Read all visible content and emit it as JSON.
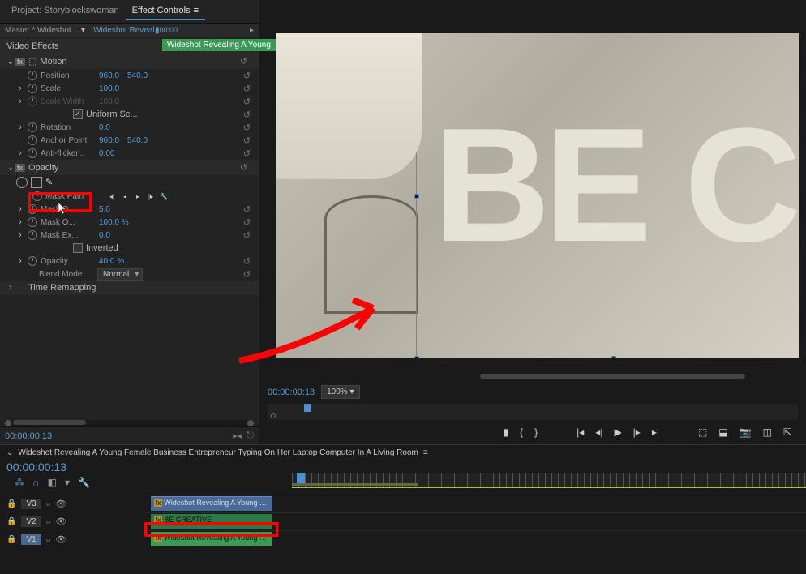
{
  "tabs": {
    "project": "Project: Storyblockswoman",
    "effectControls": "Effect Controls"
  },
  "header": {
    "master": "Master * Wideshot...",
    "clip": "Wideshot Reveal...",
    "time": "00:00"
  },
  "tooltip": "Wideshot Revealing A Young",
  "videoEffectsLabel": "Video Effects",
  "motion": {
    "label": "Motion",
    "position": {
      "label": "Position",
      "x": "960.0",
      "y": "540.0"
    },
    "scale": {
      "label": "Scale",
      "value": "100.0"
    },
    "scaleWidth": {
      "label": "Scale Width",
      "value": "100.0"
    },
    "uniform": "Uniform Sc...",
    "rotation": {
      "label": "Rotation",
      "value": "0.0"
    },
    "anchor": {
      "label": "Anchor Point",
      "x": "960.0",
      "y": "540.0"
    },
    "antiFlicker": {
      "label": "Anti-flicker...",
      "value": "0.00"
    }
  },
  "opacity": {
    "label": "Opacity",
    "maskPath": "Mask Path",
    "maskFeather": {
      "label": "Mask O...",
      "value": "5.0"
    },
    "maskOpacity": {
      "label": "Mask O...",
      "value": "100.0 %"
    },
    "maskExpansion": {
      "label": "Mask Ex...",
      "value": "0.0"
    },
    "inverted": "Inverted",
    "opacityProp": {
      "label": "Opacity",
      "value": "40.0 %"
    },
    "blendMode": {
      "label": "Blend Mode",
      "value": "Normal"
    }
  },
  "timeRemapping": "Time Remapping",
  "timecode": "00:00:00:13",
  "programText": "BE CR",
  "monitor": {
    "timecode": "00:00:00:13",
    "zoom": "100%"
  },
  "sequence": {
    "name": "Wideshot Revealing A Young Female Business Entrepreneur Typing On Her Laptop Computer In A Living Room",
    "timecode": "00:00:00:13",
    "tracks": {
      "v3": "V3",
      "v2": "V2",
      "v1": "V1"
    },
    "clips": {
      "v3": "Wideshot Revealing A Young Female Busi",
      "v2": "BE CREATIVE",
      "v1": "Wideshot Revealing A Young Female Busi"
    }
  }
}
